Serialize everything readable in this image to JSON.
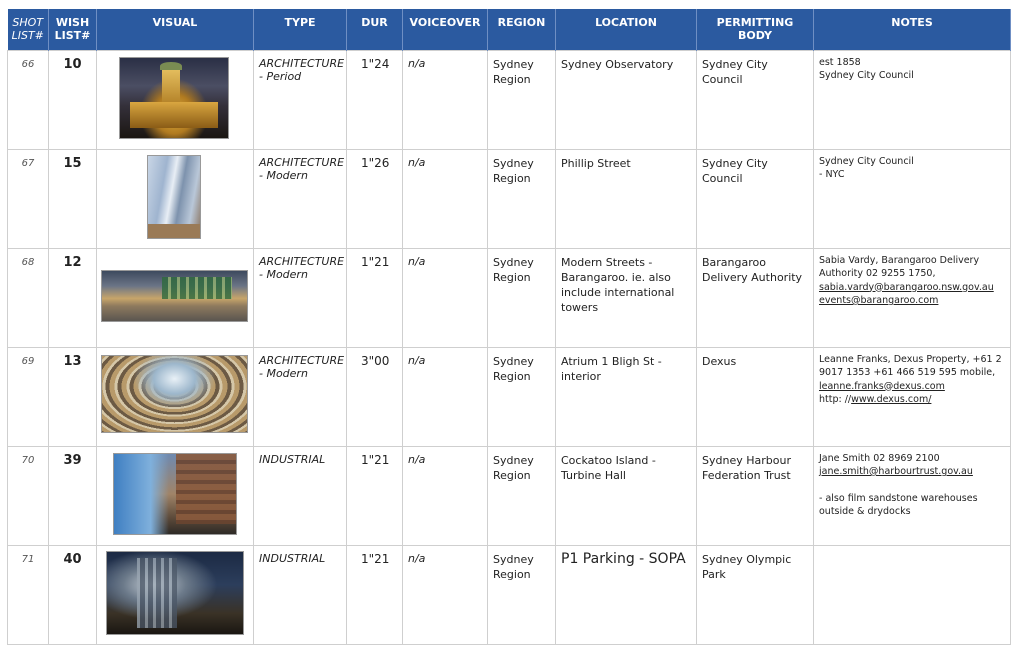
{
  "headers": {
    "shot": "SHOT LIST#",
    "wish": "WISH LIST#",
    "visual": "VISUAL",
    "type": "TYPE",
    "dur": "DUR",
    "voiceover": "VOICEOVER",
    "region": "REGION",
    "location": "LOCATION",
    "permitting": "PERMITTING BODY",
    "notes": "NOTES"
  },
  "rows": [
    {
      "shot": "66",
      "wish": "10",
      "visual": "sydney-observatory-photo",
      "type": "ARCHITECTURE - Period",
      "dur": "1\"24",
      "voiceover": "n/a",
      "region": "Sydney Region",
      "location": "Sydney Observatory",
      "permitting": "Sydney City Council",
      "notes": [
        "est 1858",
        "Sydney City Council"
      ]
    },
    {
      "shot": "67",
      "wish": "15",
      "visual": "phillip-street-photo",
      "type": "ARCHITECTURE - Modern",
      "dur": "1\"26",
      "voiceover": "n/a",
      "region": "Sydney Region",
      "location": "Phillip Street",
      "permitting": "Sydney City Council",
      "notes": [
        "Sydney City Council",
        "- NYC"
      ]
    },
    {
      "shot": "68",
      "wish": "12",
      "visual": "barangaroo-street-photo",
      "type": "ARCHITECTURE - Modern",
      "dur": "1\"21",
      "voiceover": "n/a",
      "region": "Sydney Region",
      "location": "Modern Streets - Barangaroo. ie. also include international towers",
      "permitting": "Barangaroo Delivery Authority",
      "notes": [
        "Sabia Vardy, Barangaroo Delivery Authority 02 9255 1750,",
        "sabia.vardy@barangaroo.nsw.gov.au",
        "events@barangaroo.com"
      ]
    },
    {
      "shot": "69",
      "wish": "13",
      "visual": "atrium-bligh-st-photo",
      "type": "ARCHITECTURE - Modern",
      "dur": "3\"00",
      "voiceover": "n/a",
      "region": "Sydney Region",
      "location": "Atrium 1 Bligh St - interior",
      "permitting": "Dexus",
      "notes": [
        "Leanne Franks, Dexus Property, +61 2 9017 1353 +61 466 519 595 mobile,",
        "leanne.franks@dexus.com",
        "http: //",
        "www.dexus.com/"
      ]
    },
    {
      "shot": "70",
      "wish": "39",
      "visual": "cockatoo-island-photo",
      "type": "INDUSTRIAL",
      "dur": "1\"21",
      "voiceover": "n/a",
      "region": "Sydney Region",
      "location": "Cockatoo Island - Turbine Hall",
      "permitting": "Sydney Harbour Federation Trust",
      "notes": [
        "Jane Smith 02 8969 2100",
        "jane.smith@harbourtrust.gov.au",
        "- also film sandstone warehouses outside & drydocks"
      ]
    },
    {
      "shot": "71",
      "wish": "40",
      "visual": "p1-parking-photo",
      "type": "INDUSTRIAL",
      "dur": "1\"21",
      "voiceover": "n/a",
      "region": "Sydney Region",
      "location": "P1 Parking - SOPA",
      "permitting": "Sydney Olympic Park",
      "notes": []
    }
  ]
}
